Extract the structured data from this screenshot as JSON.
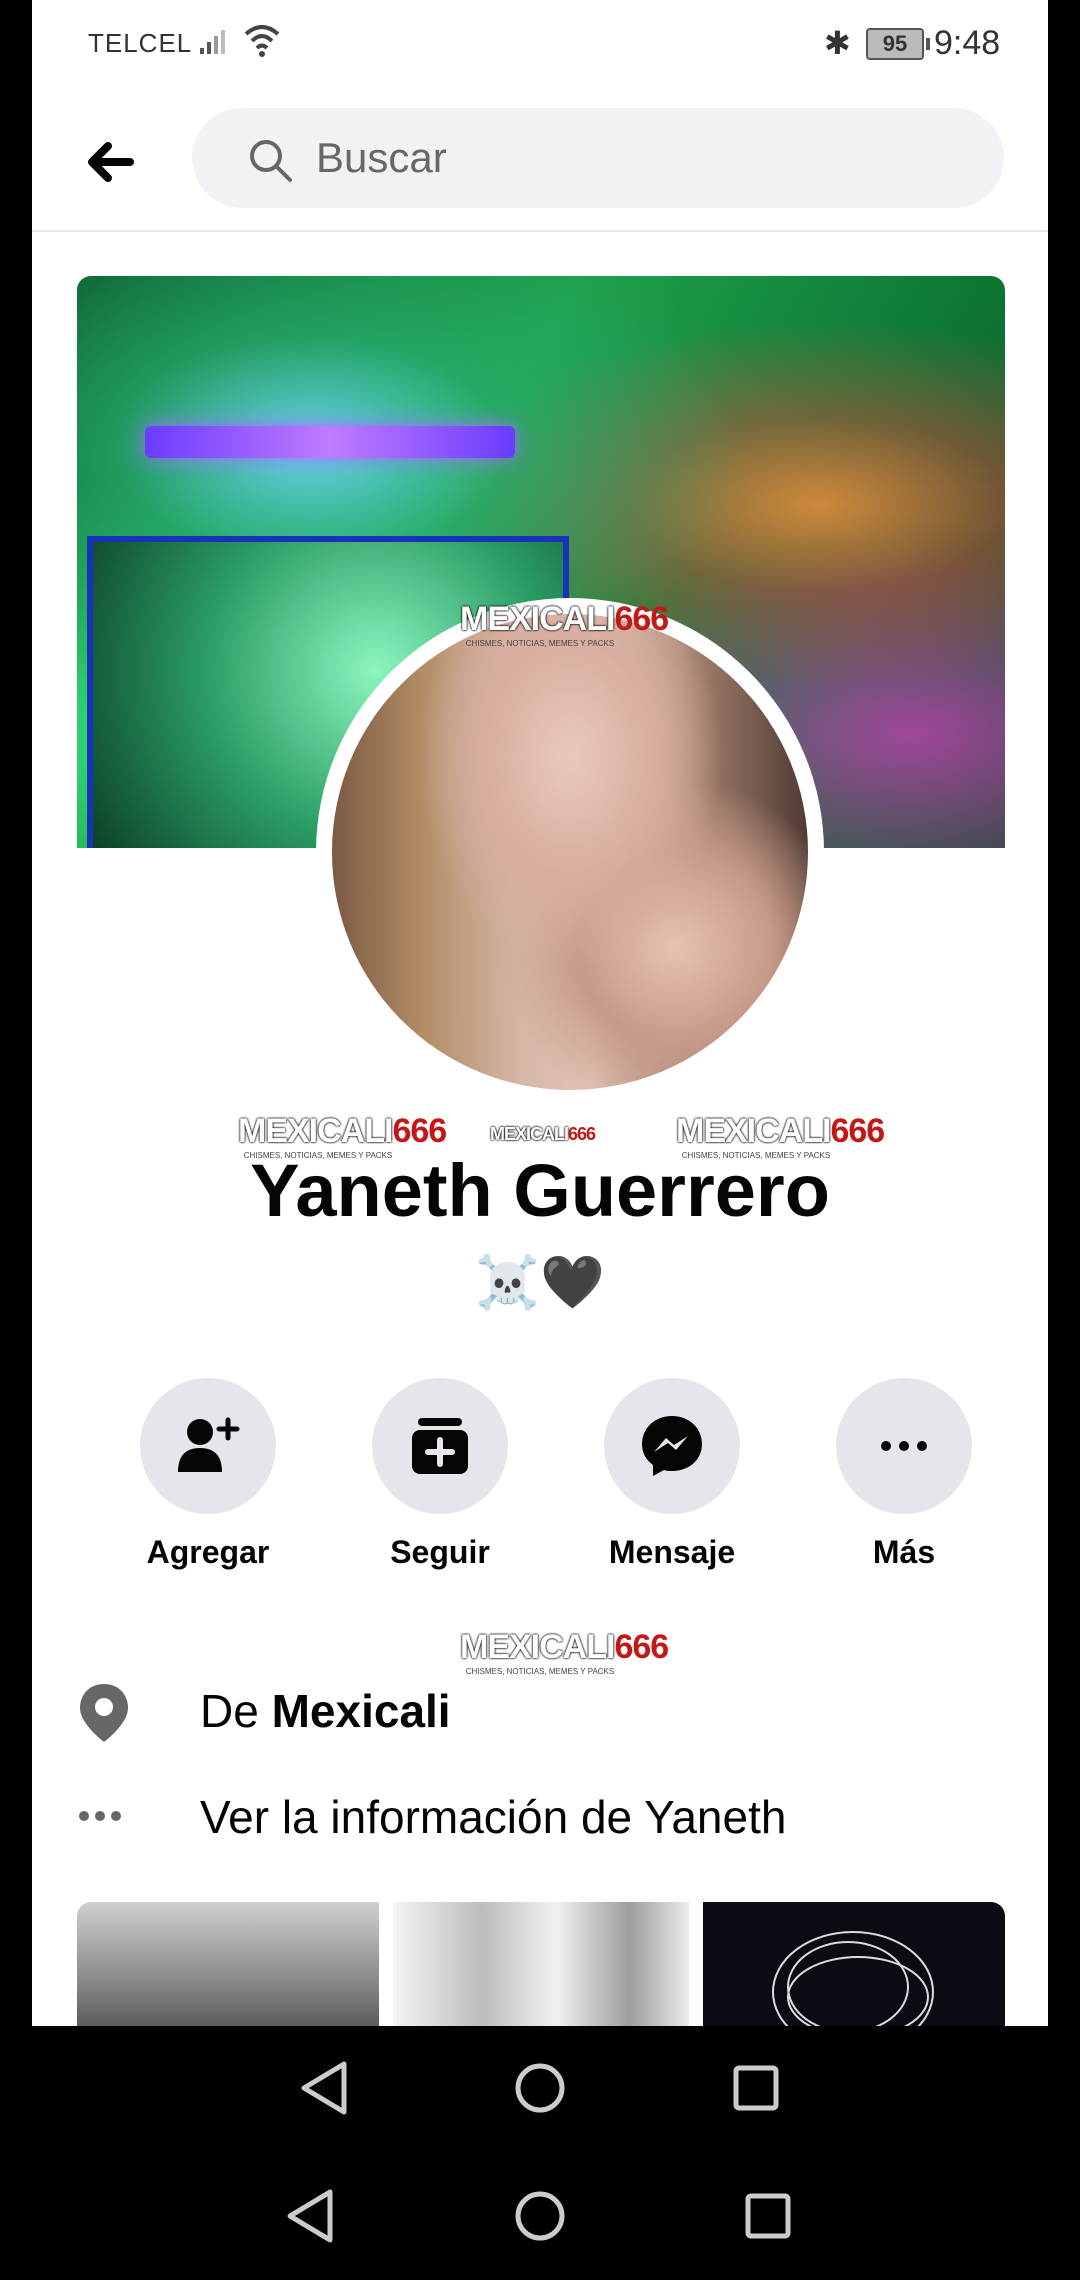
{
  "status_bar": {
    "carrier": "TELCEL",
    "battery": "95",
    "time": "9:48"
  },
  "search": {
    "placeholder": "Buscar"
  },
  "watermark": {
    "text_white": "MEXICALI",
    "text_red": "666",
    "tagline": "CHISMES, NOTICIAS, MEMES Y PACKS"
  },
  "profile": {
    "name": "Yaneth Guerrero",
    "bio_emoji": "☠️🖤"
  },
  "actions": [
    {
      "label": "Agregar",
      "icon": "add-friend-icon"
    },
    {
      "label": "Seguir",
      "icon": "follow-icon"
    },
    {
      "label": "Mensaje",
      "icon": "messenger-icon"
    },
    {
      "label": "Más",
      "icon": "more-icon"
    }
  ],
  "info": {
    "location_prefix": "De",
    "location_city": "Mexicali",
    "more_info": "Ver la información de Yaneth"
  },
  "colors": {
    "watermark_red": "#c41818",
    "button_bg": "#e4e6eb",
    "search_bg": "#f0f2f5"
  }
}
